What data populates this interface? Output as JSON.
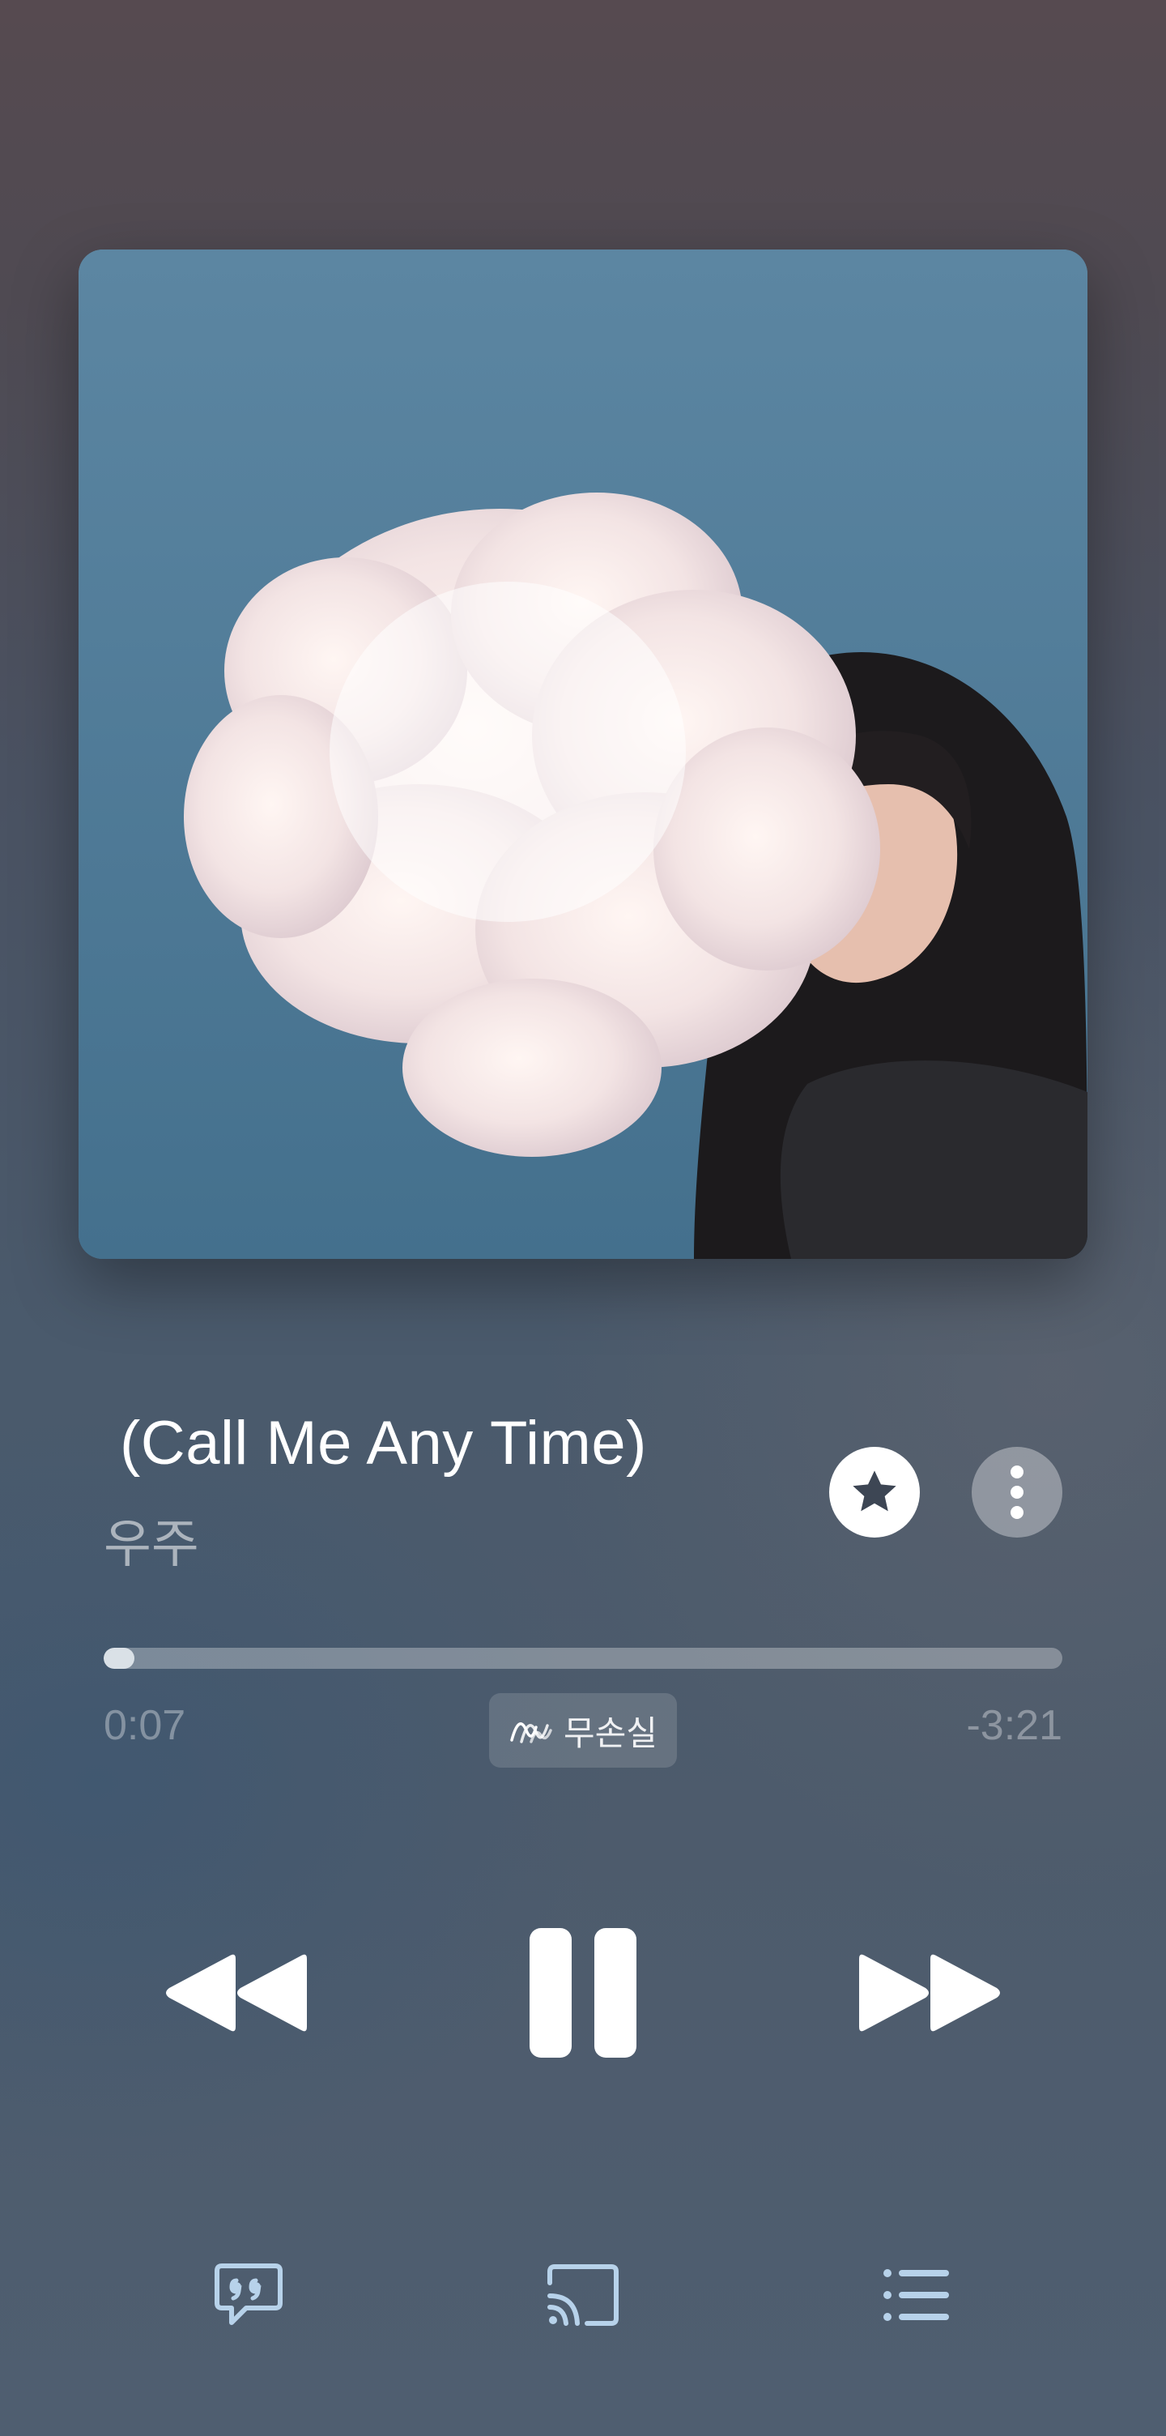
{
  "track": {
    "title": "(Call Me Any Time)",
    "artist": "우주"
  },
  "playback": {
    "elapsed": "0:07",
    "remaining": "-3:21",
    "progress_fraction": 0.03,
    "quality_label": "무손실",
    "state": "playing"
  },
  "icons": {
    "favorite": "star-icon",
    "more": "more-vertical-icon",
    "quality": "waveform-icon",
    "previous": "rewind-icon",
    "play_pause": "pause-icon",
    "next": "fast-forward-icon",
    "lyrics": "lyrics-quote-icon",
    "cast": "cast-icon",
    "queue": "queue-list-icon"
  },
  "colors": {
    "accent": "#ffffff",
    "muted_text": "#9aa3ad"
  }
}
